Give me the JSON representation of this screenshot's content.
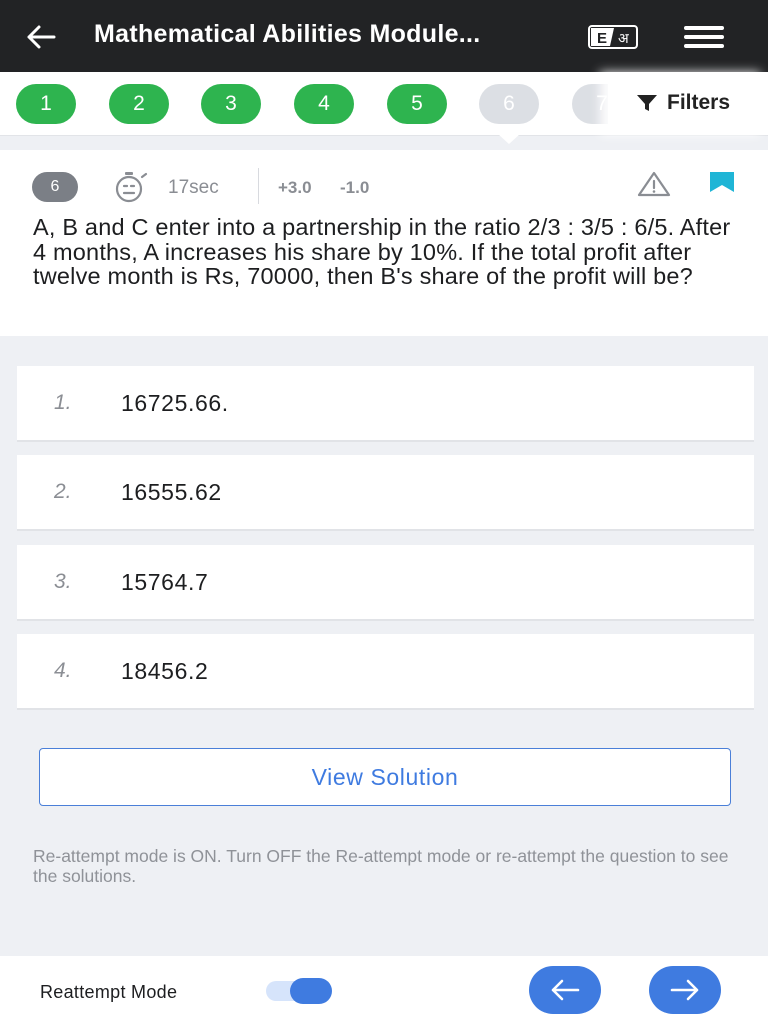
{
  "header": {
    "title": "Mathematical Abilities Module...",
    "back_icon": "arrow-left-icon",
    "language_icon": "language-toggle-icon",
    "menu_icon": "hamburger-menu-icon"
  },
  "question_nav": {
    "items": [
      "1",
      "2",
      "3",
      "4",
      "5",
      "6",
      "7"
    ],
    "current": "6",
    "filters_label": "Filters",
    "filter_icon": "funnel-icon"
  },
  "question": {
    "number": "6",
    "timer": "17sec",
    "positive_marks": "+3.0",
    "negative_marks": "-1.0",
    "text": "A, B and C enter into a partnership in the ratio 2/3 : 3/5 : 6/5. After 4 months, A increases his share by 10%. If the total profit after twelve month is Rs, 70000, then B's share of the profit will be?",
    "timer_icon": "stopwatch-icon",
    "report_icon": "warning-icon",
    "bookmark_icon": "bookmark-icon"
  },
  "options": [
    {
      "num": "1.",
      "value": "16725.66."
    },
    {
      "num": "2.",
      "value": "16555.62"
    },
    {
      "num": "3.",
      "value": "15764.7"
    },
    {
      "num": "4.",
      "value": "18456.2"
    }
  ],
  "view_solution_label": "View Solution",
  "info_text": "Re-attempt mode is ON. Turn OFF the Re-attempt mode or re-attempt the question to see the solutions.",
  "footer": {
    "reattempt_label": "Reattempt Mode",
    "reattempt_on": true,
    "prev_icon": "arrow-left-icon",
    "next_icon": "arrow-right-icon"
  },
  "colors": {
    "header_bg": "#222325",
    "answered": "#2eb44f",
    "accent": "#3f7be0",
    "bookmark": "#1fb5d6"
  }
}
